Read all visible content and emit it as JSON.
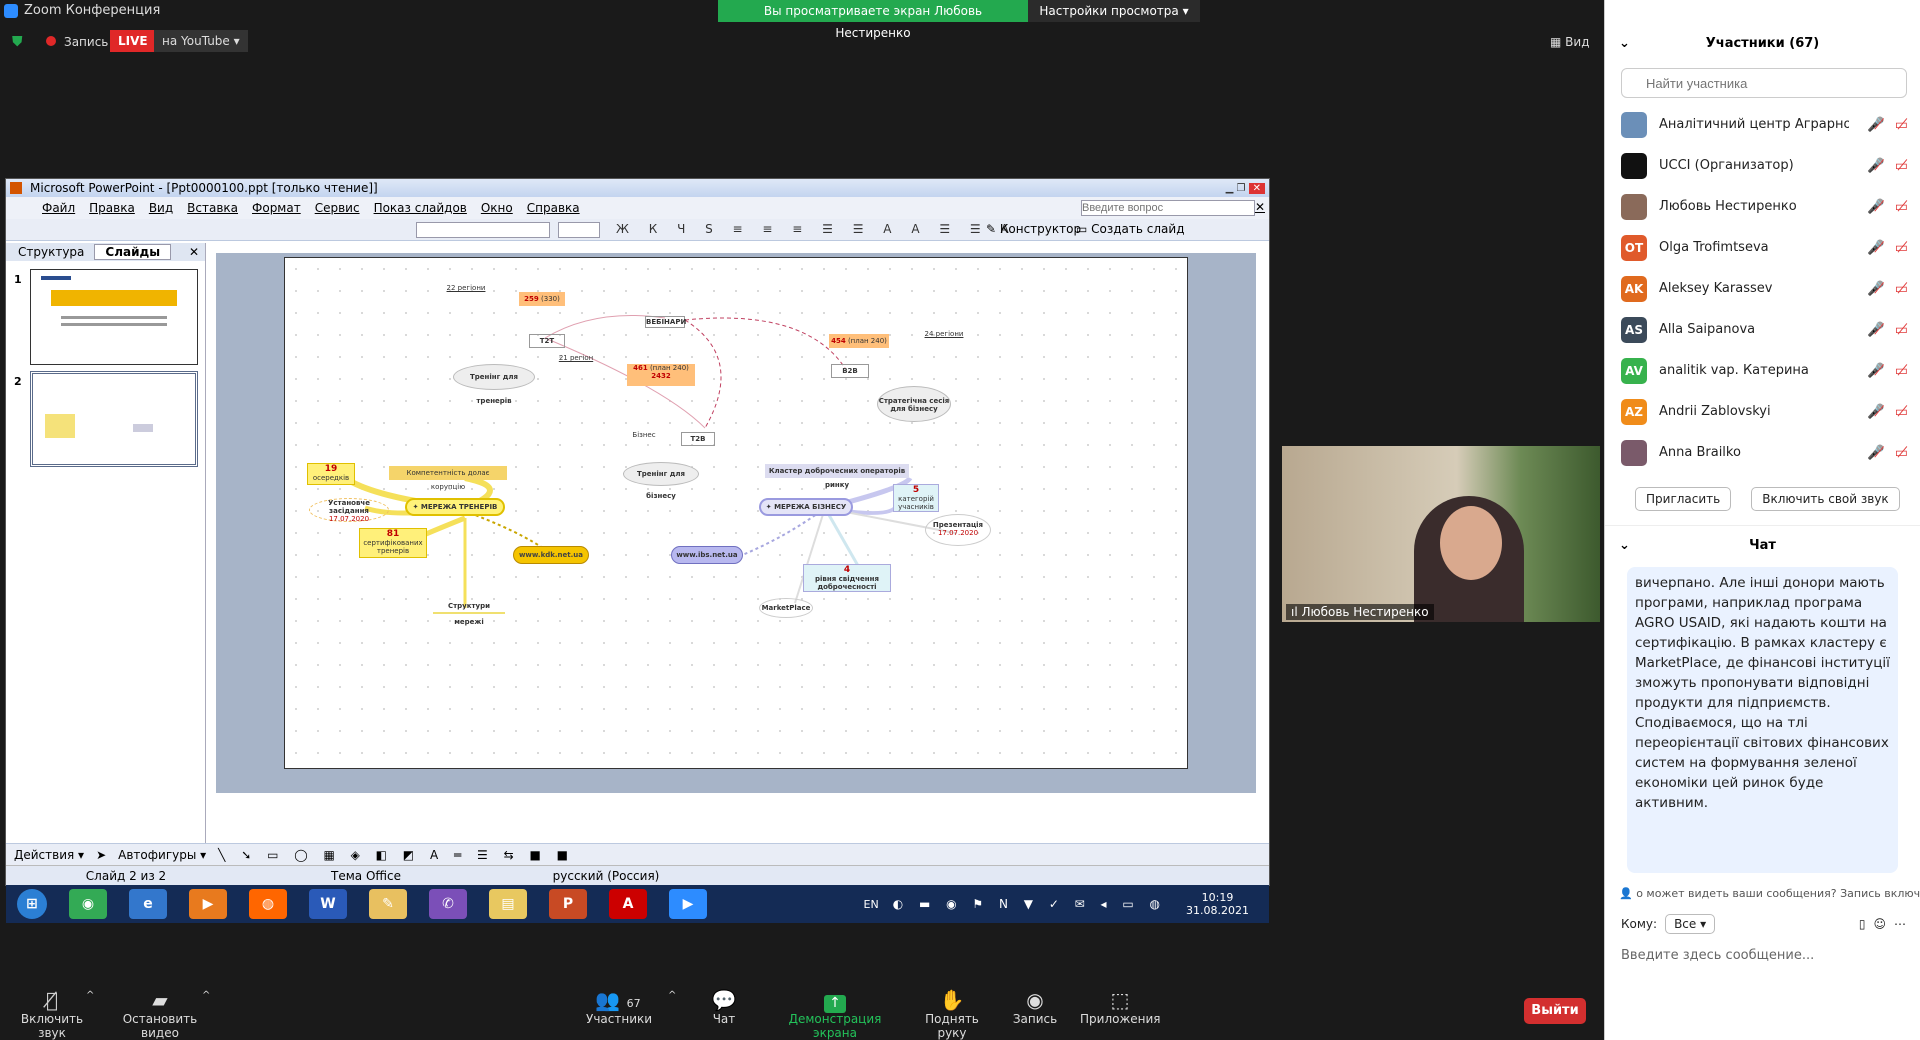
{
  "window": {
    "title": "Zoom Конференция"
  },
  "banner": {
    "viewing": "Вы просматриваете экран Любовь Нестиренко",
    "settings": "Настройки просмотра"
  },
  "topbar": {
    "record": "Запись",
    "live": "LIVE",
    "youtube": "на YouTube",
    "view": "Вид"
  },
  "ppt": {
    "title": "Microsoft PowerPoint - [Ppt0000100.ppt [только чтение]]",
    "menu": [
      "Файл",
      "Правка",
      "Вид",
      "Вставка",
      "Формат",
      "Сервис",
      "Показ слайдов",
      "Окно",
      "Справка"
    ],
    "ask_placeholder": "Введите вопрос",
    "designer": "Конструктор",
    "create_slide": "Создать слайд",
    "tabs": {
      "outline": "Структура",
      "slides": "Слайды"
    },
    "slide_numbers": [
      "1",
      "2"
    ],
    "status": {
      "slide": "Слайд 2 из 2",
      "theme": "Тема Office",
      "lang": "русский (Россия)"
    },
    "drawbar": {
      "actions": "Действия",
      "autoshapes": "Автофигуры"
    },
    "slide": {
      "n19": "19",
      "n19_label": "осередків",
      "competence": "Компетентність долає корупцію",
      "trainers_net": "МЕРЕЖА ТРЕНЕРІВ",
      "founding": "Установче засідання",
      "founding_date": "17.07.2020",
      "n81": "81",
      "n81_label": "сертифікованих тренерів",
      "kdk": "www.kdk.net.ua",
      "structures": "Структури мережі",
      "n259": "259",
      "n259_plan": "(330)",
      "t2t": "T2T",
      "webinars": "ВЕБІНАРИ",
      "trainings_trainers": "Тренінг для тренерів",
      "n461": "461",
      "n461_plan": "(план 240)",
      "n2432": "2432",
      "t2b": "T2B",
      "biz": "Бізнес",
      "trainings_business": "Тренінг для бізнесу",
      "n454": "454",
      "n454_plan": "(план 240)",
      "b2b": "B2B",
      "strategic": "Стратегічна сесія для бізнесу",
      "cluster": "Кластер доброчесних операторів ринку",
      "business_net": "МЕРЕЖА БІЗНЕСУ",
      "n5": "5",
      "n5_label": "категорій учасників",
      "presentation": "Презентація",
      "presentation_date": "17.07.2020",
      "ibs": "www.ibs.net.ua",
      "n4": "4",
      "n4_label": "рівня свідчення доброчесності",
      "marketplace": "MarketPlace",
      "regions22": "22 регіони",
      "regions21": "21 регіон",
      "regions24": "24 регіони"
    }
  },
  "taskbar": {
    "lang": "EN",
    "time": "10:19",
    "date": "31.08.2021"
  },
  "video": {
    "name": "Любовь Нестиренко"
  },
  "participants": {
    "header": "Участники (67)",
    "search_placeholder": "Найти участника",
    "list": [
      {
        "initials": "",
        "name": "Аналітичний центр Аграрно... (Я)",
        "color": "#6b8fb8"
      },
      {
        "initials": "",
        "name": "UCCI (Организатор)",
        "color": "#111111"
      },
      {
        "initials": "",
        "name": "Любовь Нестиренко",
        "color": "#8a6a5a"
      },
      {
        "initials": "OT",
        "name": "Olga Trofimtseva",
        "color": "#e05a2b"
      },
      {
        "initials": "AK",
        "name": "Aleksey Karassev",
        "color": "#e06a1e"
      },
      {
        "initials": "AS",
        "name": "Alla Saipanova",
        "color": "#3b4a5a"
      },
      {
        "initials": "AV",
        "name": "analitik vap. Катерина",
        "color": "#37b24d"
      },
      {
        "initials": "AZ",
        "name": "Andrii Zablovskyi",
        "color": "#f08c1a"
      },
      {
        "initials": "",
        "name": "Anna Brailko",
        "color": "#7a5a6a"
      }
    ],
    "invite": "Пригласить",
    "unmute_self": "Включить свой звук"
  },
  "chat": {
    "header": "Чат",
    "message": "вичерпано. Але інші донори мають програми, наприклад програма AGRO USAID, які надають кошти на сертифікацію. В рамках кластеру є MarketPlace, де фінансові інституції зможуть пропонувати відповідні продукти для підприємств. Сподіваємося, що на тлі переорієнтації світових фінансових систем на формування зеленої економіки цей ринок буде активним.",
    "notice": "о может видеть ваши сообщения? Запись включе",
    "to_label": "Кому:",
    "to_value": "Все",
    "input_placeholder": "Введите здесь сообщение..."
  },
  "bottombar": {
    "unmute": "Включить звук",
    "stop_video": "Остановить видео",
    "participants": "Участники",
    "participants_count": "67",
    "chat": "Чат",
    "share": "Демонстрация экрана",
    "raise_hand": "Поднять руку",
    "record": "Запись",
    "apps": "Приложения",
    "leave": "Выйти"
  },
  "colors": {
    "accent_green": "#23a94f",
    "leave_red": "#d32f2f",
    "live_red": "#e02828"
  }
}
